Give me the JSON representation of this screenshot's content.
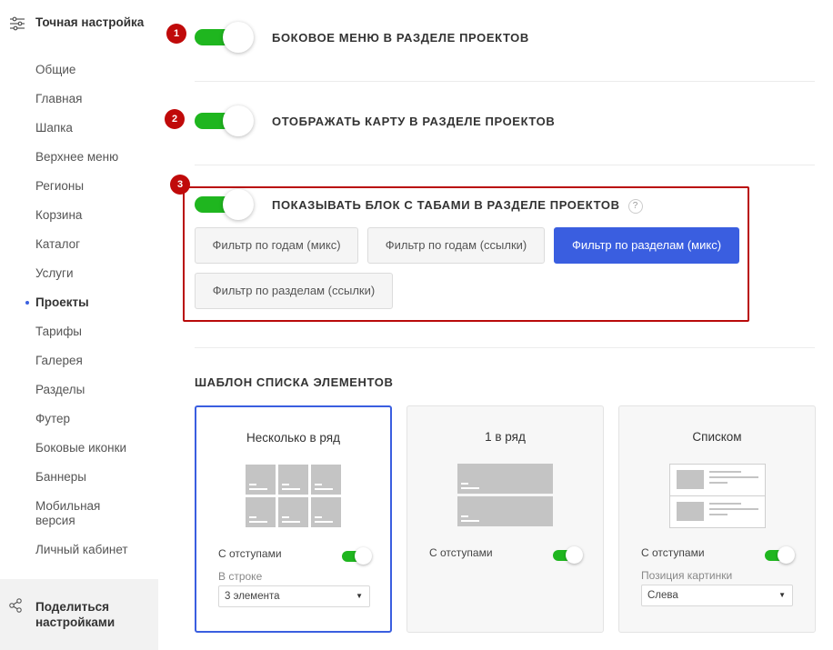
{
  "sidebar": {
    "title": "Точная настройка",
    "items": [
      {
        "label": "Общие"
      },
      {
        "label": "Главная"
      },
      {
        "label": "Шапка"
      },
      {
        "label": "Верхнее меню"
      },
      {
        "label": "Регионы"
      },
      {
        "label": "Корзина"
      },
      {
        "label": "Каталог"
      },
      {
        "label": "Услуги"
      },
      {
        "label": "Проекты",
        "active": true
      },
      {
        "label": "Тарифы"
      },
      {
        "label": "Галерея"
      },
      {
        "label": "Разделы"
      },
      {
        "label": "Футер"
      },
      {
        "label": "Боковые иконки"
      },
      {
        "label": "Баннеры"
      },
      {
        "label": "Мобильная версия"
      },
      {
        "label": "Личный кабинет"
      }
    ],
    "share_label": "Поделиться настройками"
  },
  "settings": [
    {
      "badge": "1",
      "label": "БОКОВОЕ МЕНЮ В РАЗДЕЛЕ ПРОЕКТОВ",
      "enabled": true
    },
    {
      "badge": "2",
      "label": "ОТОБРАЖАТЬ КАРТУ В РАЗДЕЛЕ ПРОЕКТОВ",
      "enabled": true
    },
    {
      "badge": "3",
      "label": "ПОКАЗЫВАТЬ БЛОК С ТАБАМИ В РАЗДЕЛЕ ПРОЕКТОВ",
      "enabled": true,
      "help": "?"
    }
  ],
  "tabs": [
    {
      "label": "Фильтр по годам (микс)",
      "active": false
    },
    {
      "label": "Фильтр по годам (ссылки)",
      "active": false
    },
    {
      "label": "Фильтр по разделам (микс)",
      "active": true
    },
    {
      "label": "Фильтр по разделам (ссылки)",
      "active": false
    }
  ],
  "template_section": {
    "title": "ШАБЛОН СПИСКА ЭЛЕМЕНТОВ",
    "cards": [
      {
        "title": "Несколько в ряд",
        "option": "С отступами",
        "option_enabled": true,
        "sub_label": "В строке",
        "select_value": "3 элемента",
        "selected": true
      },
      {
        "title": "1 в ряд",
        "option": "С отступами",
        "option_enabled": true,
        "selected": false
      },
      {
        "title": "Списком",
        "option": "С отступами",
        "option_enabled": true,
        "sub_label": "Позиция картинки",
        "select_value": "Слева",
        "selected": false
      }
    ]
  },
  "colors": {
    "accent": "#3a5ee0",
    "toggle_on": "#1fb61f",
    "annotation": "#c00a0a"
  }
}
